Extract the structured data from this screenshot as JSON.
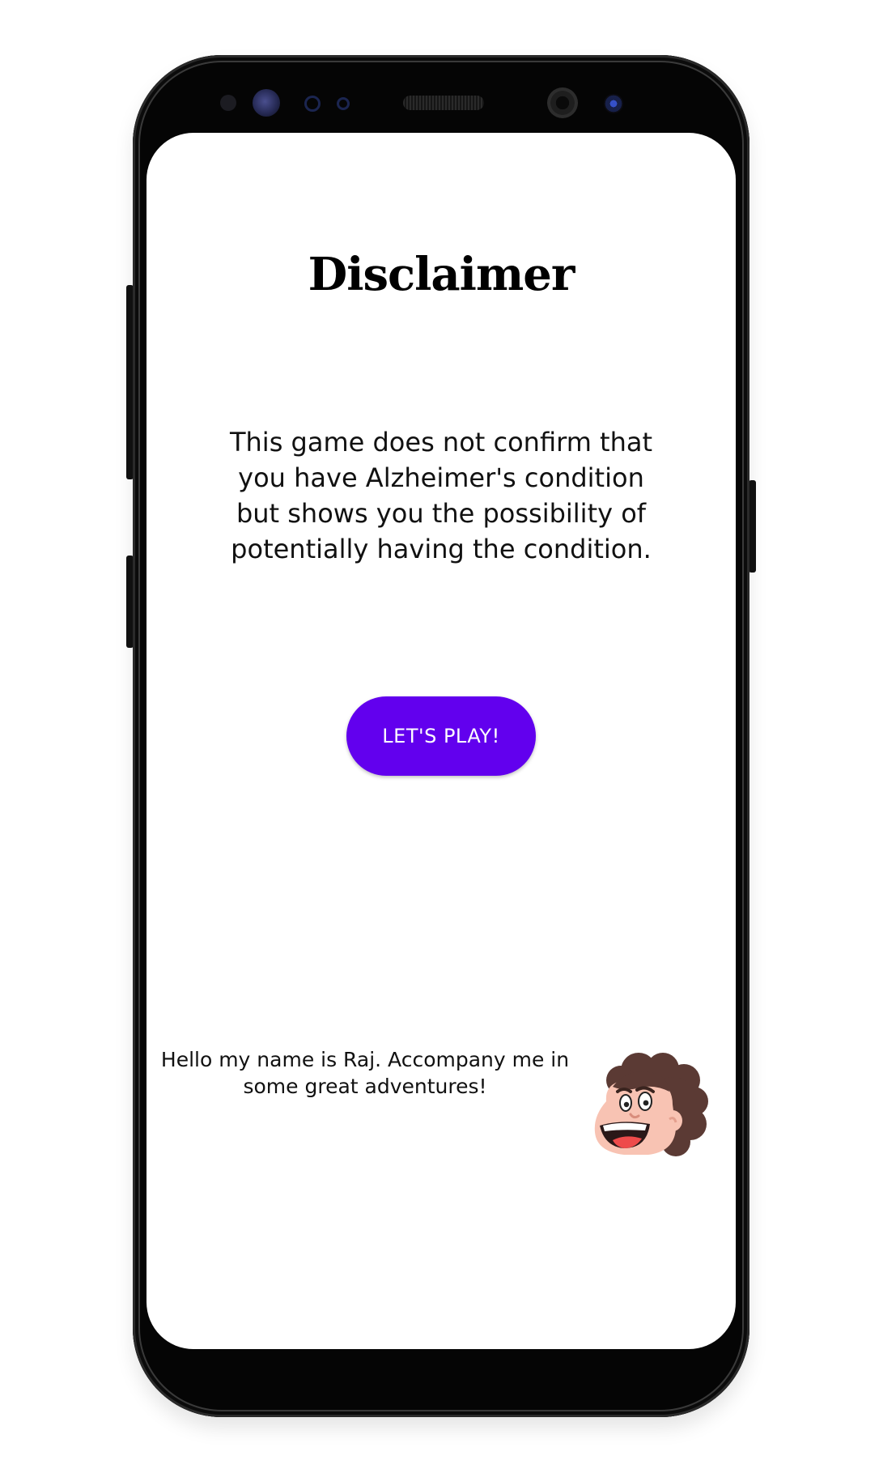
{
  "disclaimer": {
    "title": "Disclaimer",
    "body": "This game does not confirm that you have Alzheimer's condition but shows you the possibility of potentially having the condition."
  },
  "actions": {
    "play_label": "LET'S PLAY!"
  },
  "mascot": {
    "greeting": "Hello my name is Raj. Accompany me in some great adventures!",
    "icon": "raj-mascot-face"
  },
  "colors": {
    "primary_button": "#6200ee",
    "button_text": "#ffffff",
    "screen_background": "#ffffff"
  }
}
